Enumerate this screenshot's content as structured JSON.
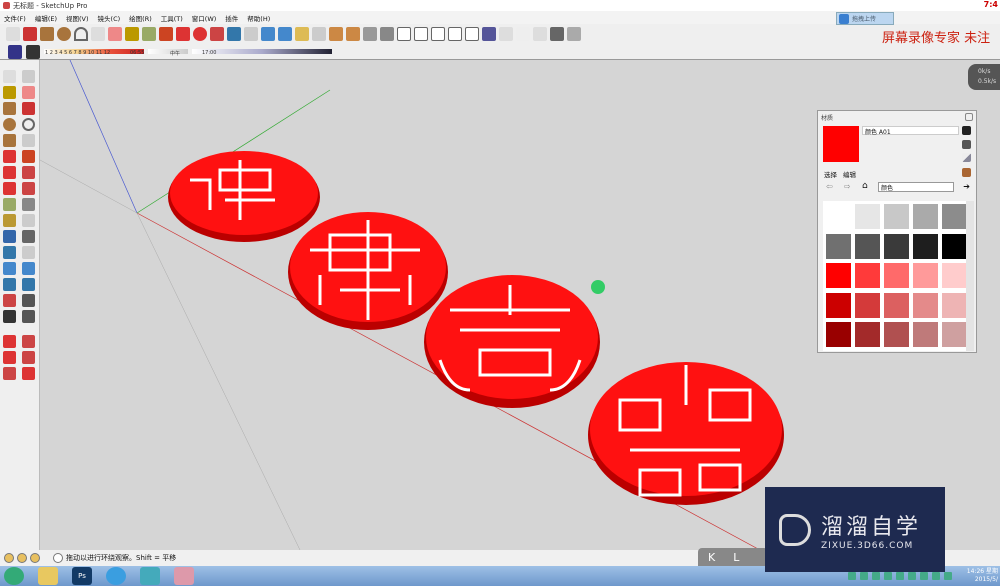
{
  "window": {
    "title": "无标题 - SketchUp Pro",
    "clock": "7:4"
  },
  "menu": [
    "文件(F)",
    "编辑(E)",
    "视图(V)",
    "镜头(C)",
    "绘图(R)",
    "工具(T)",
    "窗口(W)",
    "插件",
    "帮助(H)"
  ],
  "shadow": {
    "months": "1 2 3 4 5 6 7 8 9 10 11 12",
    "start_time": "06:55",
    "noon": "中午",
    "end_time": "17:00"
  },
  "overlay": {
    "upload_label": "拖拽上传",
    "recorder_text": "屏幕录像专家 未注",
    "speed_up": "0k/s",
    "speed_down": "0.5k/s"
  },
  "materials": {
    "title": "材质",
    "name": "颜色 A01",
    "tab_select": "选择",
    "tab_edit": "编辑",
    "collection": "颜色",
    "swatches": [
      "#ffffff",
      "#e6e6e6",
      "#c8c8c8",
      "#aaaaaa",
      "#8c8c8c",
      "#707070",
      "#555555",
      "#3a3a3a",
      "#1e1e1e",
      "#000000",
      "#ff0000",
      "#ff3a3a",
      "#ff6a6a",
      "#ff9a9a",
      "#ffcccc",
      "#cc0000",
      "#d43a3a",
      "#dc6060",
      "#e48a8a",
      "#eeb4b4",
      "#990000",
      "#a32a2a",
      "#b05050",
      "#bf7a7a",
      "#cfa0a0"
    ],
    "accent": "#ff0000"
  },
  "status": {
    "hint": "拖动以进行环绕观察。Shift = 平移"
  },
  "taskbar": {
    "ps": "Ps",
    "time": "14:26 星期",
    "date": "2015/5/"
  },
  "kbar": [
    "K",
    "L"
  ],
  "watermark": {
    "brand": "溜溜自学",
    "url": "ZIXUE.3D66.COM"
  }
}
